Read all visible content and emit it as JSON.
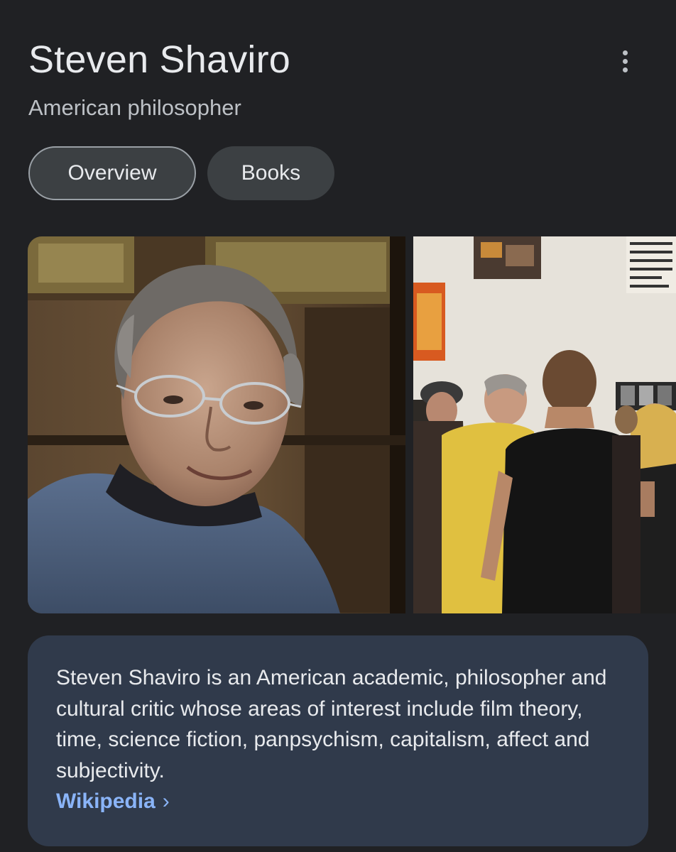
{
  "header": {
    "title": "Steven Shaviro",
    "subtitle": "American philosopher"
  },
  "tabs": [
    {
      "label": "Overview",
      "active": true
    },
    {
      "label": "Books",
      "active": false
    }
  ],
  "images": [
    {
      "icon": "portrait-photo"
    },
    {
      "icon": "gallery-event-photo"
    }
  ],
  "description": {
    "text": "Steven Shaviro is an American academic, philosopher and cultural critic whose areas of interest include film theory, time, science fiction, panpsychism, capitalism, affect and subjectivity.",
    "source_label": "Wikipedia",
    "source_chevron": "›"
  },
  "colors": {
    "background": "#202124",
    "chip": "#3c4043",
    "card": "#303a4b",
    "link": "#8ab4f8"
  }
}
